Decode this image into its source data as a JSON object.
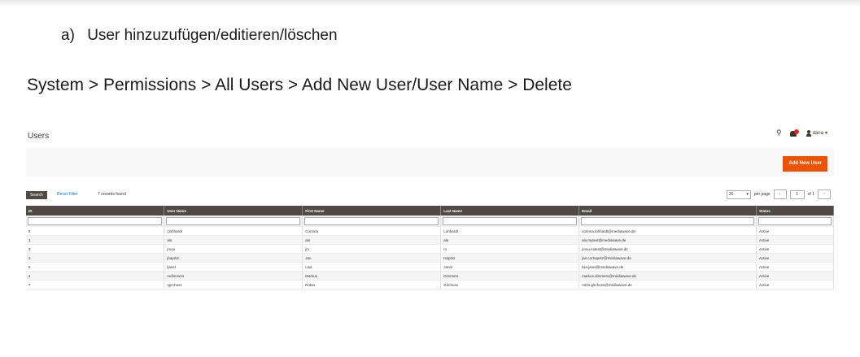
{
  "doc": {
    "item_number": "a)",
    "item_title": "User hinzuzufügen/editieren/löschen",
    "breadcrumb": "System > Permissions > All Users > Add New User/User Name > Delete"
  },
  "admin": {
    "page_title": "Users",
    "user_menu": "dana",
    "add_button": "Add New User",
    "search_button": "Search",
    "reset_filter": "Reset Filter",
    "records_found": "7 records found",
    "per_page_value": "20",
    "per_page_label": "per page",
    "page_current": "1",
    "page_total": "of 1",
    "columns": [
      "ID",
      "User Name",
      "First Name",
      "Last Name",
      "Email",
      "Status"
    ],
    "rows": [
      [
        "6",
        "clohhardt",
        "Corinna",
        "Lohhardt",
        "corinna.lohhardt@mediawave.de",
        "Active"
      ],
      [
        "1",
        "alo",
        "alo",
        "alo",
        "alo.mytest@mediawave.de",
        "Active"
      ],
      [
        "3",
        "jmou",
        "jm",
        "m",
        "jmou.mitest@mediawave.de",
        "Active"
      ],
      [
        "2",
        "jhaprkz",
        "Jan",
        "Haprkz",
        "jan.corhaprkz@mediawave.de",
        "Active"
      ],
      [
        "5",
        "ljanel",
        "Lisa",
        "Janel",
        "lisa.janel@mediawave.de",
        "Active"
      ],
      [
        "4",
        "mdimmers",
        "Markus",
        "Dimmers",
        "markus.dimmers@mediawave.de",
        "Active"
      ],
      [
        "7",
        "rgirchuss",
        "Robin",
        "Girchuss",
        "robin.girchuss@mediawave.de",
        "Active"
      ]
    ]
  },
  "colors": {
    "accent": "#eb5202",
    "header_dark": "#514943",
    "link": "#007bdb"
  }
}
